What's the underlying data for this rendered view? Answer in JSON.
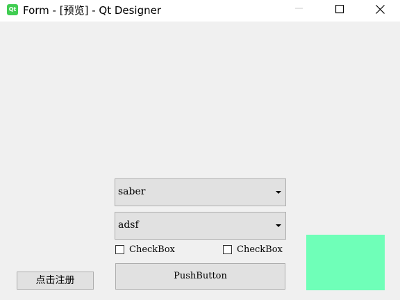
{
  "window": {
    "title": "Form - [预览] - Qt Designer",
    "app_icon_text": "Qt",
    "colors": {
      "titlebar": "#ffffff",
      "background": "#f0f0f0",
      "green_panel": "#6fffb8"
    },
    "controls": [
      "minimize-icon",
      "maximize-icon",
      "close-icon"
    ]
  },
  "form": {
    "combo1": {
      "value": "saber"
    },
    "combo2": {
      "value": "adsf"
    },
    "checkbox1": {
      "label": "CheckBox",
      "checked": false
    },
    "checkbox2": {
      "label": "CheckBox",
      "checked": false
    },
    "push_button": {
      "label": "PushButton"
    },
    "register_button": {
      "label": "点击注册"
    }
  }
}
